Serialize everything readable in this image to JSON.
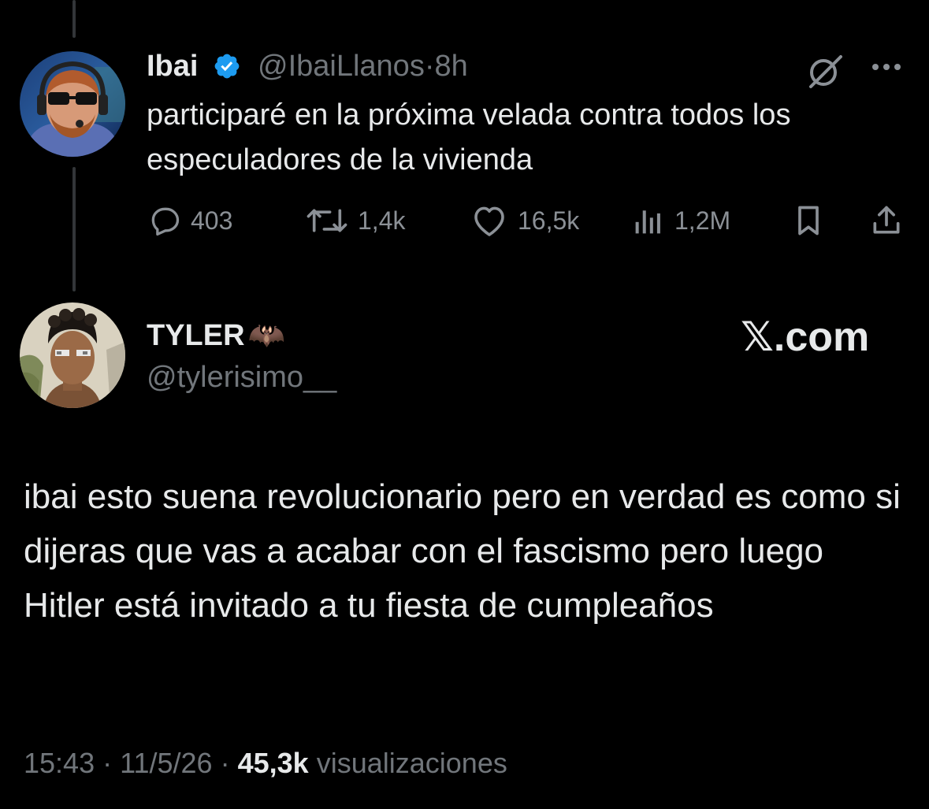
{
  "quoted_tweet": {
    "author_name": "Ibai",
    "author_handle": "@IbaiLlanos",
    "separator": "·",
    "time_ago": "8h",
    "text": "participaré en la próxima velada contra todos los especuladores de la vivienda",
    "metrics": {
      "replies": "403",
      "reposts": "1,4k",
      "likes": "16,5k",
      "views": "1,2M"
    }
  },
  "main_tweet": {
    "author_name": "TYLER",
    "name_emoji": "🦇",
    "author_handle": "@tylerisimo__",
    "watermark": "𝕏.com",
    "text": "ibai esto suena revolucionario pero en verdad es como si dijeras que vas a acabar con el fascismo pero luego Hitler está invitado a tu fiesta de cumpleaños",
    "time": "15:43",
    "sep1": "·",
    "date": "11/5/26",
    "sep2": "·",
    "views_count": "45,3k",
    "views_label": "visualizaciones"
  },
  "colors": {
    "background": "#000000",
    "text_primary": "#e7e9ea",
    "text_secondary": "#71767b",
    "verified_blue": "#1d9bf0",
    "thread_line": "#333639"
  },
  "icons": [
    "verified-badge-icon",
    "grok-icon",
    "more-icon",
    "reply-icon",
    "repost-icon",
    "like-icon",
    "views-icon",
    "bookmark-icon",
    "share-icon"
  ]
}
